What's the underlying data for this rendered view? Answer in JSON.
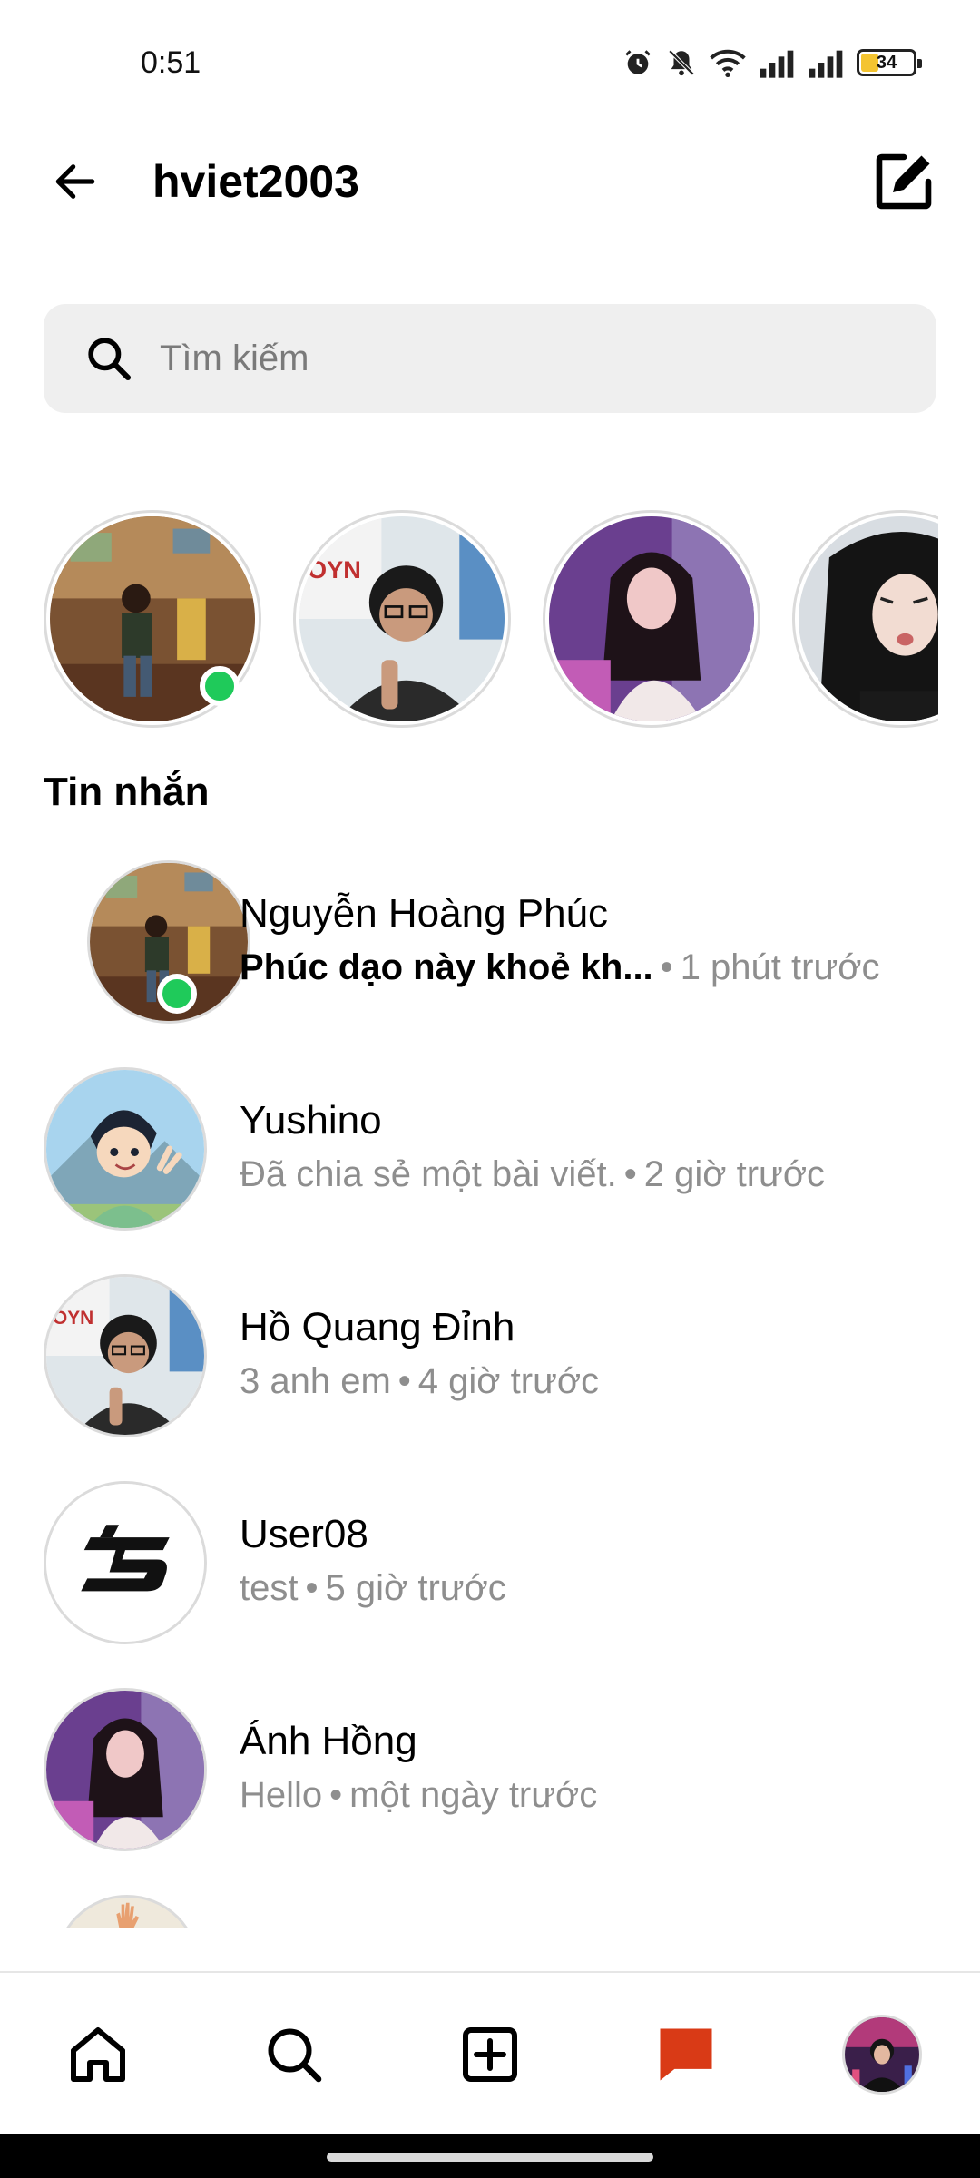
{
  "status_bar": {
    "time": "0:51",
    "battery": "34",
    "battery_level": 0.34
  },
  "header": {
    "title": "hviet2003",
    "back_icon": "back-arrow-icon",
    "compose_icon": "compose-icon"
  },
  "search": {
    "placeholder": "Tìm kiếm",
    "value": ""
  },
  "stories": [
    {
      "name": "story-1",
      "online": true
    },
    {
      "name": "story-2",
      "online": false
    },
    {
      "name": "story-3",
      "online": false
    },
    {
      "name": "story-4",
      "online": false
    }
  ],
  "section_title": "Tin nhắn",
  "messages": [
    {
      "name": "Nguyễn Hoàng Phúc",
      "preview": "Phúc dạo này khoẻ kh...",
      "time": "1 phút trước",
      "unread": true,
      "online": true
    },
    {
      "name": "Yushino",
      "preview": "Đã chia sẻ một bài viết.",
      "time": "2 giờ trước",
      "unread": false,
      "online": false
    },
    {
      "name": "Hồ Quang Đỉnh",
      "preview": "3 anh em",
      "time": "4 giờ trước",
      "unread": false,
      "online": false
    },
    {
      "name": "User08",
      "preview": "test",
      "time": "5 giờ trước",
      "unread": false,
      "online": false
    },
    {
      "name": "Ánh Hồng",
      "preview": "Hello",
      "time": "một ngày trước",
      "unread": false,
      "online": false
    }
  ],
  "separator": "•",
  "bottom_nav": {
    "items": [
      "home-icon",
      "search-icon",
      "add-post-icon",
      "messages-icon",
      "profile-avatar"
    ],
    "active": "messages-icon",
    "accent": "#d93a16"
  },
  "colors": {
    "online": "#1fca5a",
    "muted_text": "#8e8e8e",
    "search_bg": "#efefef"
  }
}
